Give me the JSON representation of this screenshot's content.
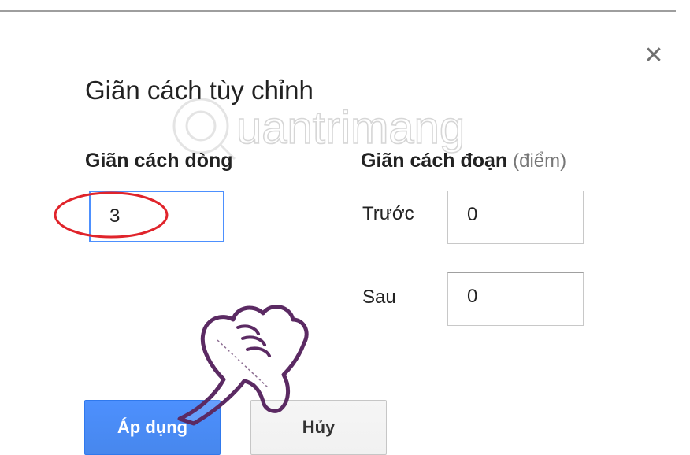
{
  "dialog": {
    "title": "Giãn cách tùy chỉnh",
    "close_glyph": "✕"
  },
  "line_spacing": {
    "label": "Giãn cách dòng",
    "value": "3"
  },
  "paragraph_spacing": {
    "label": "Giãn cách đoạn",
    "unit_note": "(điểm)",
    "before": {
      "label": "Trước",
      "value": "0"
    },
    "after": {
      "label": "Sau",
      "value": "0"
    }
  },
  "buttons": {
    "apply_label": "Áp dụng",
    "cancel_label": "Hủy"
  },
  "watermark": {
    "text": "uantrimang"
  },
  "colors": {
    "primary_button": "#4d90fe",
    "focus_border": "#4d90fe",
    "annotation_red": "#e0242b",
    "hand_outline": "#5b2a63"
  },
  "icons": {
    "close": "close-icon",
    "pointer": "pointing-hand-icon"
  }
}
